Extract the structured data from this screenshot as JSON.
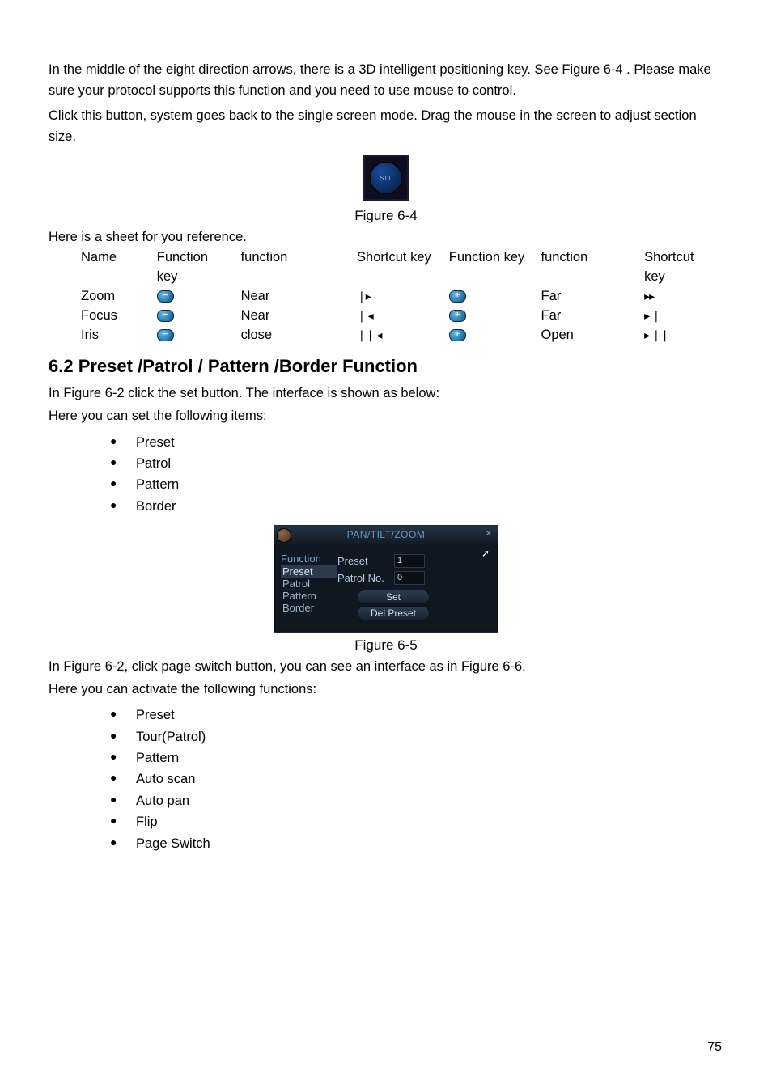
{
  "intro": {
    "p1": "In the middle of the eight direction arrows, there is a 3D intelligent positioning key. See Figure 6-4 . Please make sure your protocol supports this function and you need to use mouse to control.",
    "p2": "Click this button, system goes back to the single screen mode. Drag the mouse in the screen to adjust section size."
  },
  "sit_label": "SIT",
  "fig64": "Figure 6-4",
  "ref_intro": "Here is a sheet for you reference.",
  "table": {
    "headers": {
      "name": "Name",
      "fk": "Function key",
      "fn": "function",
      "sk": "Shortcut key",
      "fk2": "Function key",
      "fn2": "function",
      "sk2": "Shortcut key"
    },
    "rows": [
      {
        "name": "Zoom",
        "fk": "−",
        "fn": "Near",
        "sk": "❘▸",
        "fk2": "+",
        "fn2": "Far",
        "sk2": "▸▸"
      },
      {
        "name": "Focus",
        "fk": "−",
        "fn": "Near",
        "sk": "❘ ◂",
        "fk2": "+",
        "fn2": "Far",
        "sk2": "▸ ❘"
      },
      {
        "name": "Iris",
        "fk": "−",
        "fn": "close",
        "sk": "❘❘ ◂",
        "fk2": "+",
        "fn2": "Open",
        "sk2": "▸ ❘❘"
      }
    ]
  },
  "section_title": "6.2  Preset  /Patrol / Pattern /Border  Function",
  "sec1": {
    "p1": "In Figure 6-2 click the set button. The interface is shown as below:",
    "p2": "Here you can set the following items:",
    "items": [
      "Preset",
      "Patrol",
      "Pattern",
      "Border"
    ]
  },
  "ptz": {
    "title": "PAN/TILT/ZOOM",
    "close": "✕",
    "side_header": "Function",
    "side": [
      "Preset",
      "Patrol",
      "Pattern",
      "Border"
    ],
    "preset_label": "Preset",
    "preset_val": "1",
    "patrol_label": "Patrol No.",
    "patrol_val": "0",
    "btn_set": "Set",
    "btn_del": "Del Preset"
  },
  "fig65": "Figure 6-5",
  "sec2": {
    "p1": "In Figure 6-2, click page switch button, you can see an interface as in Figure 6-6.",
    "p2": "Here you can activate the following functions:",
    "items": [
      "Preset",
      "Tour(Patrol)",
      "Pattern",
      "Auto scan",
      "Auto pan",
      "Flip",
      "Page Switch"
    ]
  },
  "page_number": "75"
}
